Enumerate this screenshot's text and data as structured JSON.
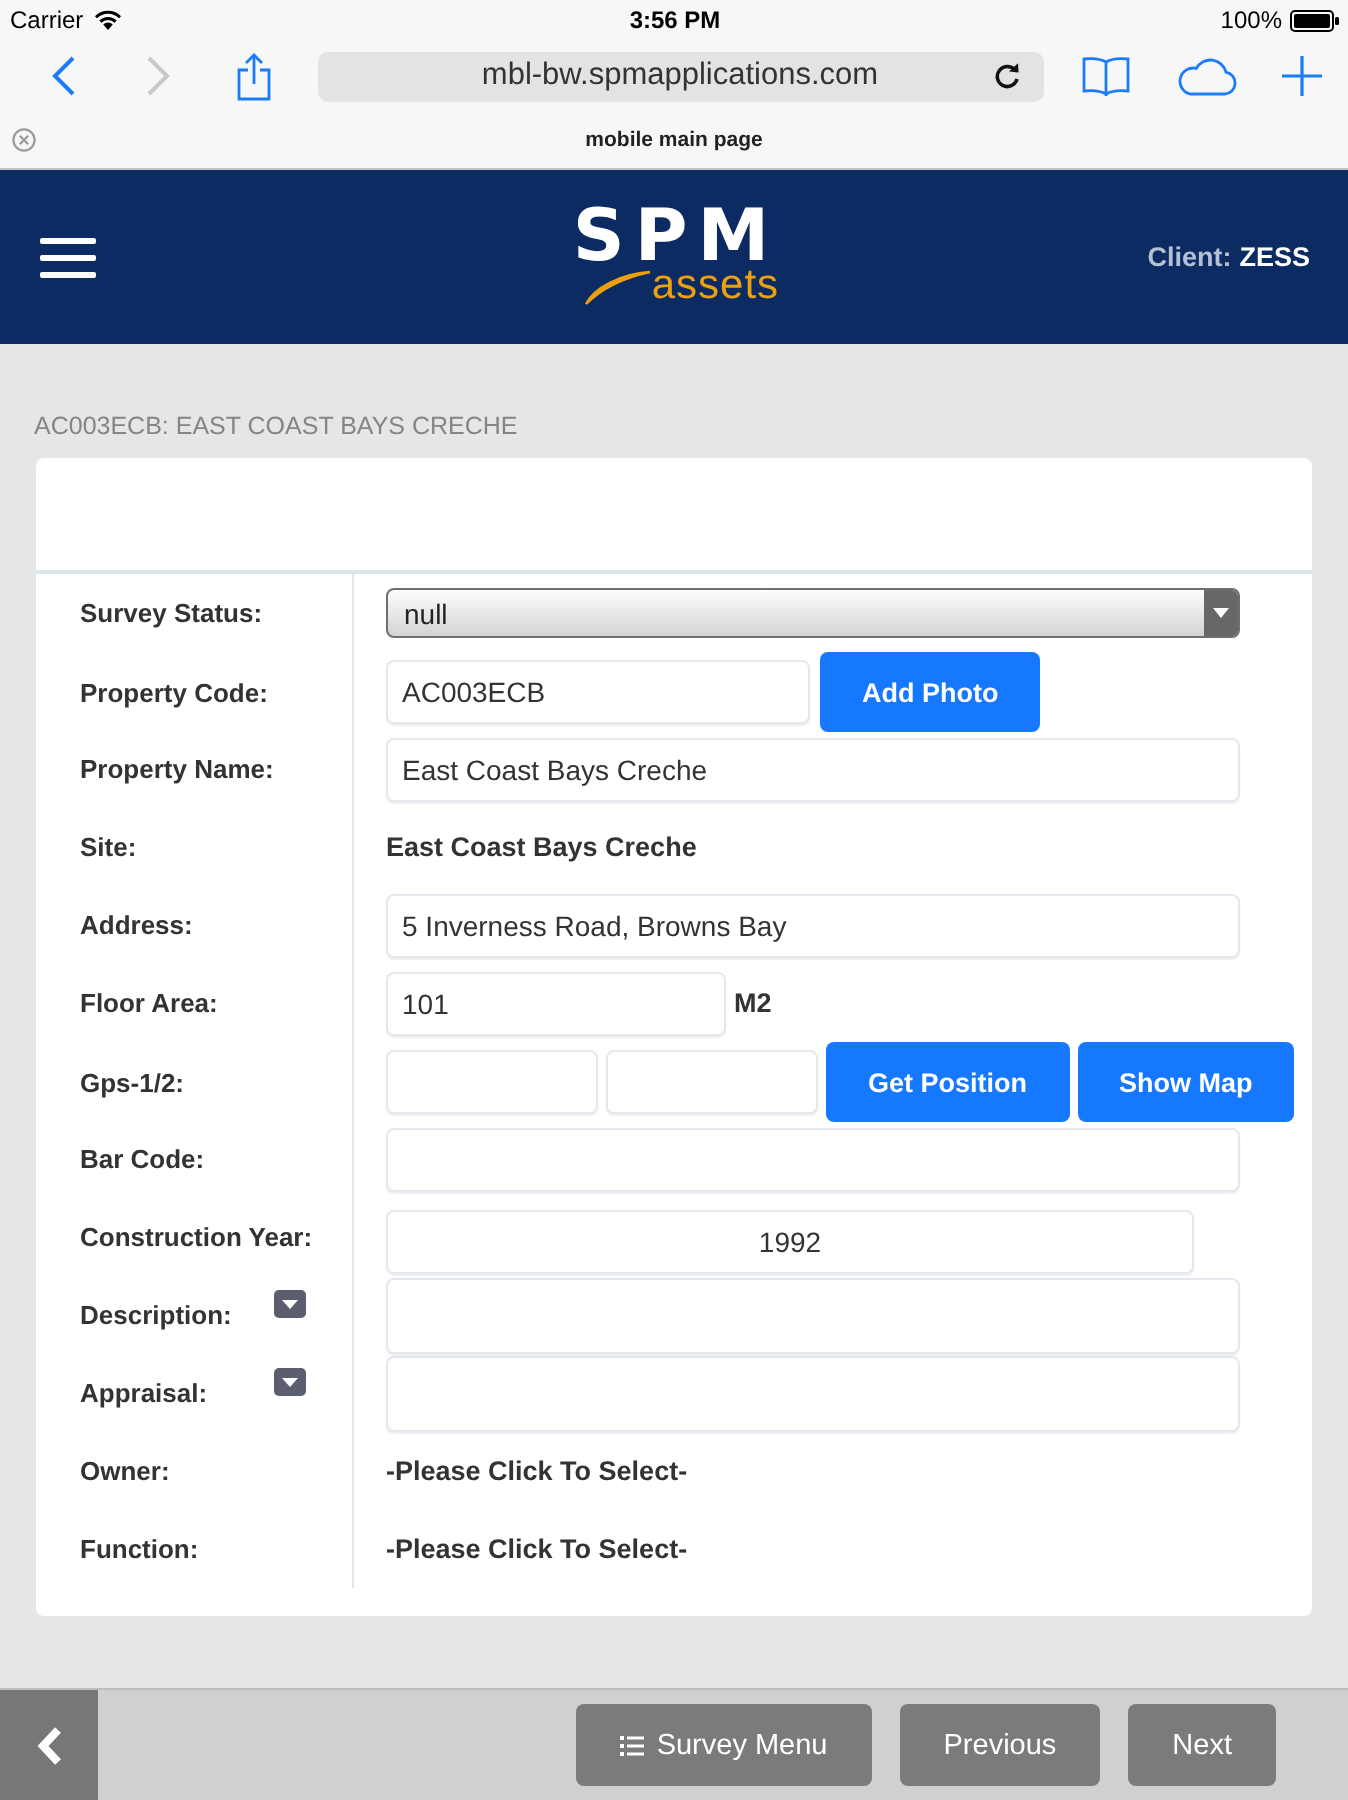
{
  "status_bar": {
    "carrier": "Carrier",
    "time": "3:56 PM",
    "battery": "100%"
  },
  "browser": {
    "nav_buttons": [
      {
        "kind": "back",
        "disabled": false
      },
      {
        "kind": "forward",
        "disabled": true
      }
    ],
    "url": "mbl-bw.spmapplications.com",
    "tab_title": "mobile main page"
  },
  "header": {
    "logo": {
      "wordmark": "SPM",
      "tagline": "assets"
    },
    "client_label": "Client:",
    "client_name": "ZESS"
  },
  "page_title": "AC003ECB: EAST COAST BAYS CRECHE",
  "form": {
    "rows": [
      {
        "kind": "select",
        "label": "Survey Status:",
        "value": "null"
      },
      {
        "kind": "input_button",
        "label": "Property Code:",
        "value": "AC003ECB",
        "buttons": [
          "Add Photo"
        ]
      },
      {
        "kind": "input",
        "label": "Property Name:",
        "value": "East Coast Bays Creche"
      },
      {
        "kind": "text",
        "label": "Site:",
        "value": "East Coast Bays Creche"
      },
      {
        "kind": "input",
        "label": "Address:",
        "value": "5 Inverness Road, Browns Bay"
      },
      {
        "kind": "unit",
        "label": "Floor Area:",
        "value": "101",
        "unit": "M2"
      },
      {
        "kind": "gps",
        "label": "Gps-1/2:",
        "buttons": [
          "Get Position",
          "Show Map"
        ]
      },
      {
        "kind": "input",
        "label": "Bar Code:"
      },
      {
        "kind": "number",
        "label": "Construction Year:",
        "value": "1992"
      },
      {
        "kind": "textarea",
        "label": "Description:"
      },
      {
        "kind": "textarea",
        "label": "Appraisal:"
      },
      {
        "kind": "picker",
        "label": "Owner:",
        "value": "-Please Click To Select-"
      },
      {
        "kind": "picker",
        "label": "Function:",
        "value": "-Please Click To Select-"
      }
    ]
  },
  "footer": {
    "buttons": [
      {
        "kind": "menu",
        "label": "Survey Menu"
      },
      {
        "kind": "plain",
        "label": "Previous"
      },
      {
        "kind": "plain",
        "label": "Next"
      }
    ]
  }
}
